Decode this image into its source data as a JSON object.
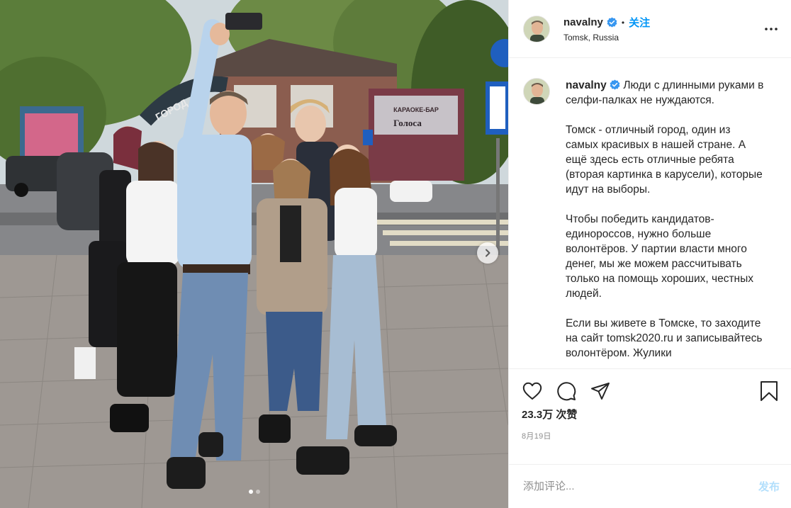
{
  "header": {
    "username": "navalny",
    "separator": "•",
    "follow_label": "关注",
    "location": "Tomsk, Russia"
  },
  "caption": {
    "username": "navalny",
    "paragraphs": [
      "Люди с длинными руками в селфи-палках не нуждаются.",
      "Томск - отличный город, один из самых красивых в нашей стране. А ещё здесь есть отличные ребята (вторая картинка в карусели), которые идут на выборы.",
      "Чтобы победить кандидатов-единороссов, нужно больше волонтёров. У партии власти много денег, мы же можем рассчитывать только на помощь хороших, честных людей.",
      "Если вы живете в Томске, то заходите на сайт tomsk2020.ru и записывайтесь волонтёром. Жулики"
    ]
  },
  "photo": {
    "sign_text": "ГОРОД",
    "billboard_title": "КАРАОКЕ-БАР",
    "billboard_name": "Голоса"
  },
  "actions": {
    "likes": "23.3万 次赞",
    "date": "8月19日"
  },
  "comment": {
    "placeholder": "添加评论...",
    "post_label": "发布"
  },
  "carousel": {
    "count": 2,
    "active": 1
  },
  "icons": {
    "verified": "verified-badge-icon",
    "more": "more-options-icon",
    "like": "heart-icon",
    "comment": "comment-bubble-icon",
    "share": "paper-plane-icon",
    "save": "bookmark-icon",
    "next": "chevron-right-icon"
  },
  "colors": {
    "accent": "#0095f6",
    "verified": "#3897f0",
    "post_disabled": "#b2dffc",
    "secondary_text": "#8e8e8e"
  }
}
